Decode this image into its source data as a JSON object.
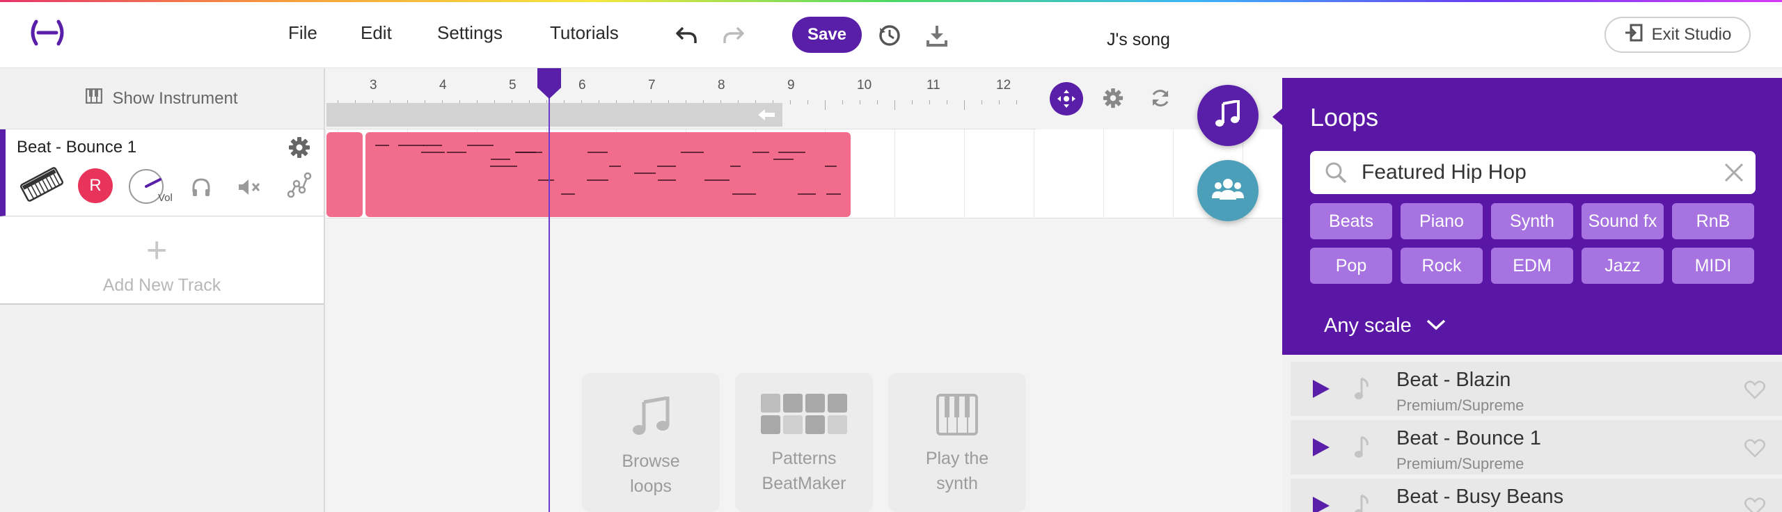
{
  "topbar": {
    "menu": [
      "File",
      "Edit",
      "Settings",
      "Tutorials"
    ],
    "save_label": "Save",
    "song_title": "J's song",
    "exit_label": "Exit Studio"
  },
  "tracks_panel": {
    "show_instrument_label": "Show Instrument",
    "track": {
      "name": "Beat - Bounce 1",
      "record_label": "R",
      "vol_label": "Vol"
    },
    "add_track_label": "Add New Track"
  },
  "timeline": {
    "bar_numbers": [
      "3",
      "4",
      "5",
      "6",
      "7",
      "8",
      "9",
      "10",
      "11",
      "12"
    ]
  },
  "empty_state": [
    {
      "label_line1": "Browse",
      "label_line2": "loops"
    },
    {
      "label_line1": "Patterns",
      "label_line2": "BeatMaker"
    },
    {
      "label_line1": "Play the",
      "label_line2": "synth"
    }
  ],
  "loops": {
    "title": "Loops",
    "search_value": "Featured Hip Hop",
    "categories_row1": [
      "Beats",
      "Piano",
      "Synth",
      "Sound fx",
      "RnB"
    ],
    "categories_row2": [
      "Pop",
      "Rock",
      "EDM",
      "Jazz",
      "MIDI"
    ],
    "scale_label": "Any scale",
    "items": [
      {
        "name": "Beat - Blazin",
        "tier": "Premium/Supreme"
      },
      {
        "name": "Beat - Bounce 1",
        "tier": "Premium/Supreme"
      },
      {
        "name": "Beat - Busy Beans",
        "tier": ""
      }
    ]
  },
  "colors": {
    "accent": "#5a1fa8",
    "clip": "#f26d8c",
    "record": "#e8335a",
    "teal": "#4b9fb8",
    "chip": "#a673e0"
  }
}
